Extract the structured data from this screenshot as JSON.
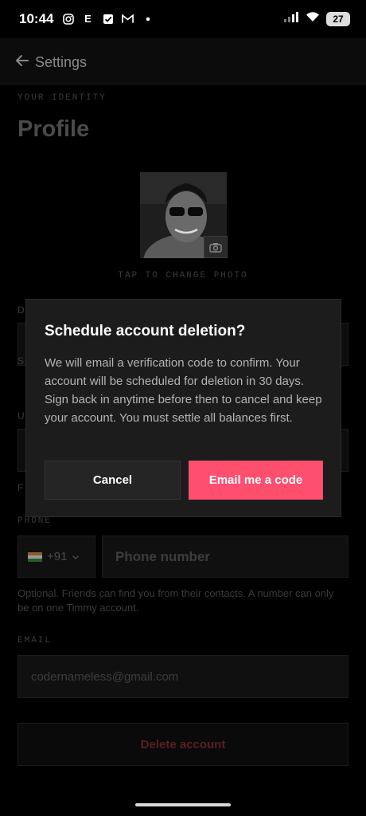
{
  "status_bar": {
    "time": "10:44",
    "left_icons": [
      "instagram-icon",
      "e-app-icon",
      "check-app-icon",
      "gmail-icon",
      "dot-icon"
    ],
    "e_glyph": "E",
    "battery": "27"
  },
  "header": {
    "title": "Settings"
  },
  "page": {
    "identity_label": "YOUR IDENTITY",
    "title": "Profile",
    "tap_label": "TAP TO CHANGE PHOTO",
    "phone": {
      "label": "PHONE",
      "country_code": "+91",
      "placeholder": "Phone number",
      "help": "Optional. Friends can find you from their contacts. A number can only be on one Timmy account."
    },
    "email": {
      "label": "EMAIL",
      "value": "codernameless@gmail.com"
    },
    "delete_label": "Delete account",
    "ghost_letters": [
      "D",
      "S",
      "U",
      "F"
    ]
  },
  "modal": {
    "title": "Schedule account deletion?",
    "body": "We will email a verification code to confirm. Your account will be scheduled for deletion in 30 days. Sign back in anytime before then to cancel and keep your account. You must settle all balances first.",
    "cancel_label": "Cancel",
    "confirm_label": "Email me a code"
  },
  "colors": {
    "accent": "#ff4f6e",
    "background": "#000000",
    "modal_bg": "#1c1c1c"
  }
}
